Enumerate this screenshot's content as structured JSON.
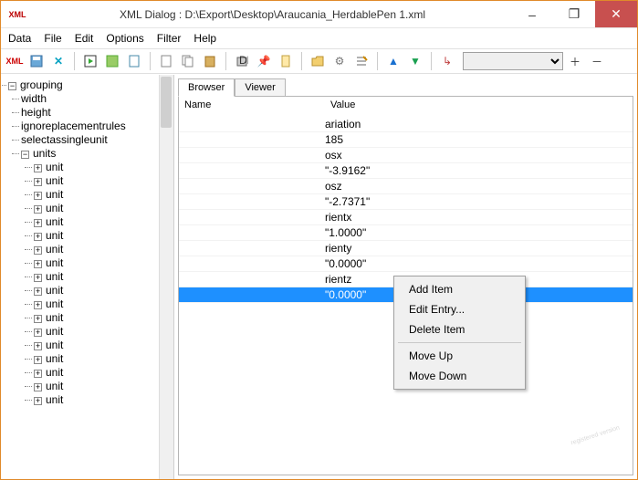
{
  "title": "XML Dialog : D:\\Export\\Desktop\\Araucania_HerdablePen 1.xml",
  "app_icon_label": "XML",
  "window_controls": {
    "min": "–",
    "max": "❐",
    "close": "✕"
  },
  "menu": [
    "Data",
    "File",
    "Edit",
    "Options",
    "Filter",
    "Help"
  ],
  "tree": {
    "root": "grouping",
    "children_top": [
      "width",
      "height",
      "ignoreplacementrules",
      "selectassingleunit"
    ],
    "units_label": "units",
    "unit_label": "unit",
    "unit_count_visible": 18
  },
  "tabs": {
    "browser": "Browser",
    "viewer": "Viewer"
  },
  "grid": {
    "headers": {
      "name": "Name",
      "value": "Value"
    },
    "rows": [
      {
        "name": "",
        "value": "ariation"
      },
      {
        "name": "",
        "value": "185"
      },
      {
        "name": "",
        "value": "osx"
      },
      {
        "name": "",
        "value": "\"-3.9162\""
      },
      {
        "name": "",
        "value": "osz"
      },
      {
        "name": "",
        "value": "\"-2.7371\""
      },
      {
        "name": "",
        "value": "rientx"
      },
      {
        "name": "",
        "value": "\"1.0000\""
      },
      {
        "name": "",
        "value": "rienty"
      },
      {
        "name": "",
        "value": "\"0.0000\""
      },
      {
        "name": "",
        "value": "rientz"
      },
      {
        "name": "",
        "value": "\"0.0000\"",
        "selected": true
      }
    ]
  },
  "context_menu": {
    "add": "Add Item",
    "edit": "Edit Entry...",
    "delete": "Delete Item",
    "up": "Move Up",
    "down": "Move Down"
  }
}
